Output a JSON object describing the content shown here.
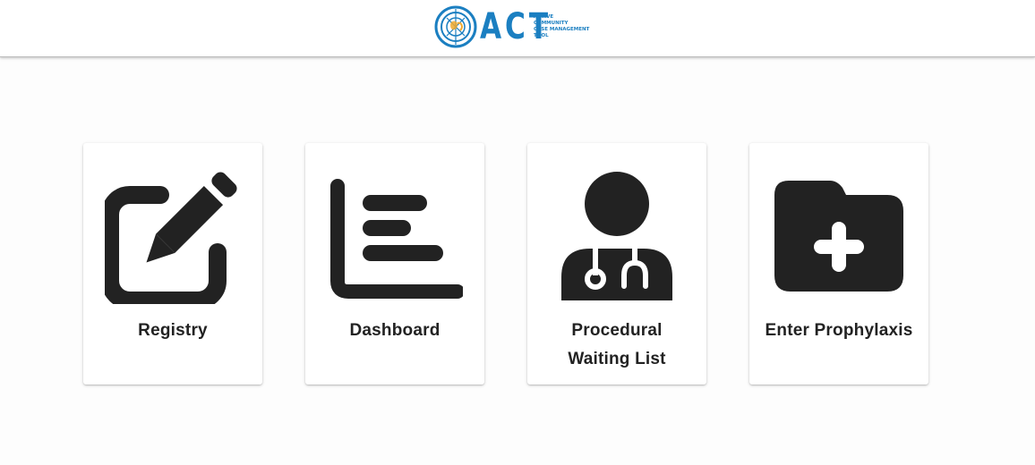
{
  "header": {
    "logo": {
      "word": "ACT",
      "subtitle_lines": [
        "ACTIVE",
        "COMMUNITY",
        "CASE MANAGEMENT",
        "TOOL"
      ]
    }
  },
  "tiles": [
    {
      "label_lines": [
        "Registry"
      ],
      "icon": "edit-icon"
    },
    {
      "label_lines": [
        "Dashboard"
      ],
      "icon": "bar-chart-icon"
    },
    {
      "label_lines": [
        "Procedural",
        "Waiting List"
      ],
      "icon": "doctor-icon"
    },
    {
      "label_lines": [
        "Enter Prophylaxis"
      ],
      "icon": "folder-plus-icon"
    }
  ],
  "colors": {
    "brand": "#1b7fc1",
    "accent": "#f0a92e",
    "icon": "#222222",
    "text": "#222222",
    "background": "#fdfdfd"
  }
}
